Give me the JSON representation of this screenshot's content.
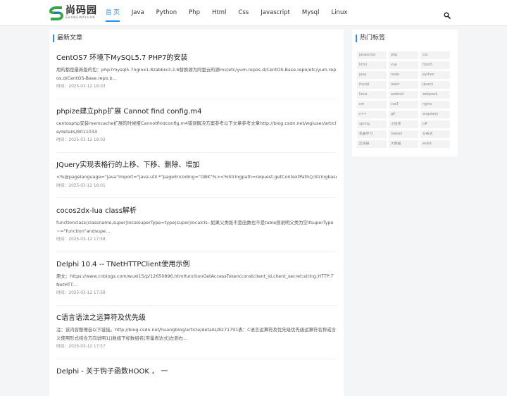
{
  "header": {
    "logo_text": "尚码园",
    "logo_sub": "SHANGMAYUAN",
    "nav": [
      {
        "label": "首 页",
        "active": true
      },
      {
        "label": "Java"
      },
      {
        "label": "Python"
      },
      {
        "label": "Php"
      },
      {
        "label": "Html"
      },
      {
        "label": "Css"
      },
      {
        "label": "Javascript"
      },
      {
        "label": "Mysql"
      },
      {
        "label": "Linux"
      }
    ],
    "search_icon": "search-icon"
  },
  "main": {
    "section_title": "最新文章",
    "articles": [
      {
        "title": "CentOS7 环境下MySQL5.7 PHP7的安装",
        "summary": "用的都是最新版的包：php7mysql5.7nginx1.8zabbix3.2.6替换源为阿里云的源mv/etc/yum.repos.d/CentOS-Base.repo/etc/yum.repos.d/CentOS-Base.repo.b…",
        "time": "时间：2025-03-12 18:03"
      },
      {
        "title": "phpize建立php扩展 Cannot find config.m4",
        "summary": "centosphp安装memcache扩展的时候报Cannotfindconfig.m4错误解决方案参考以下文章参考文章http://blog.csdn.net/wgluser/article/details/8011033",
        "time": "时间：2025-03-12 18:02"
      },
      {
        "title": "JQuery实现表格行的上移、下移、删除、增加",
        "summary": "<%@pagelanguage=\"java\"import=\"java.util.*\"pageEncoding=\"GBK\"%><%Stringpath=request.getContextPath();StringbaseP…",
        "time": "时间：2025-03-12 18:01"
      },
      {
        "title": "cocos2dx-lua class解析",
        "summary": "functionclass(classname,super)localsuperType=type(super)localcls--如果父类既不是函数也不是table则说明父类为空ifsuperType~=\"function\"andsupe…",
        "time": "时间：2025-03-12 17:58"
      },
      {
        "title": "Delphi 10.4 -- TNetHTTPClient使用示例",
        "summary": "原文：https://www.cnblogs.com/wuxi15/p/12650896.htmlfunctionGetAccessToken(constclient_id,client_secret:string;HTTP:TNetHTT…",
        "time": "时间：2025-03-12 17:58"
      },
      {
        "title": "C语言语法之运算符及优先级",
        "summary": "注：该内容整理自以下链接。http://blog.csdn.net/huangblog/article/details/8271791表：C语言运算符及优先级优先级运算符名称或含义使用形式结合方向说明1[]数组下标数组名[常量表达式]左到右…",
        "time": "时间：2025-03-12 17:57"
      },
      {
        "title": "Delphi - 关于钩子函数HOOK ， 一",
        "summary": "",
        "time": ""
      }
    ]
  },
  "sidebar": {
    "title": "热门标签",
    "tags": [
      "javascript",
      "php",
      "css",
      "html",
      "vue",
      "html5",
      "java",
      "node",
      "python",
      "mysql",
      "react",
      "jquery",
      "linux",
      "android",
      "webpack",
      "cm",
      "css3",
      "nginx",
      "c++",
      "git",
      "angularjs",
      "spring",
      "小程序",
      "c#",
      "机器学习",
      "maven",
      "分布式",
      "区块链",
      "大数据",
      "eslint"
    ]
  },
  "colors": {
    "accent": "#2d8cf0",
    "logo_green": "#3aa64a",
    "logo_blue": "#1e6fd0"
  }
}
